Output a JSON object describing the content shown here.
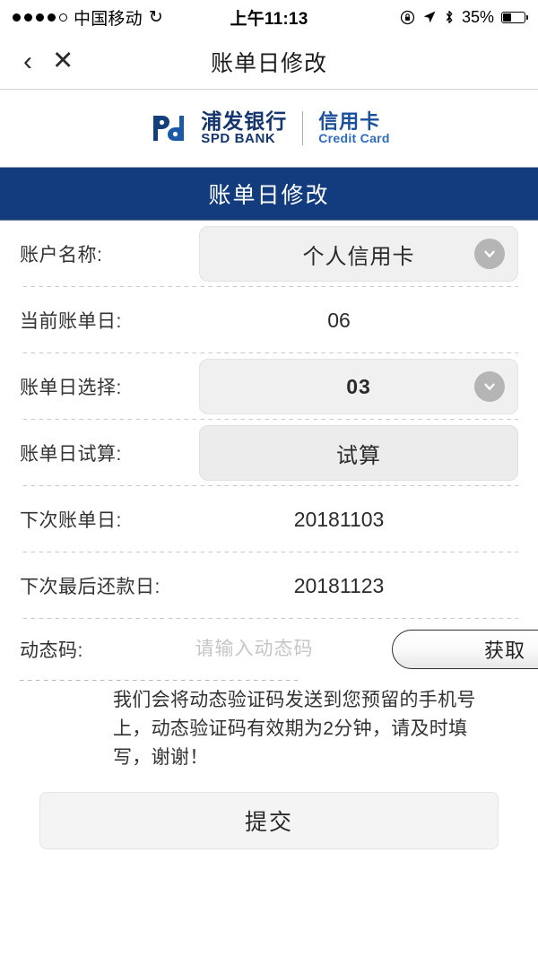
{
  "status_bar": {
    "signal_dots_filled": 4,
    "signal_dots_total": 5,
    "carrier": "中国移动",
    "sync_icon": "spiral-icon",
    "time": "上午11:13",
    "rotation_lock_icon": "rotation-lock-icon",
    "location_icon": "location-arrow-icon",
    "bluetooth_icon": "bluetooth-icon",
    "battery_percent": "35%",
    "battery_level": 35
  },
  "nav": {
    "back_icon": "chevron-left-icon",
    "close_icon": "close-icon",
    "title": "账单日修改"
  },
  "brand": {
    "logo_icon": "spd-bank-logo-icon",
    "name_cn": "浦发银行",
    "name_en": "SPD BANK",
    "product_cn": "信用卡",
    "product_en": "Credit Card",
    "color": "#15356e"
  },
  "banner": {
    "title": "账单日修改",
    "background": "#123c7e"
  },
  "form": {
    "account_name": {
      "label": "账户名称:",
      "value": "个人信用卡",
      "chevron_icon": "chevron-down-circle-icon"
    },
    "current_bill_date": {
      "label": "当前账单日:",
      "value": "06"
    },
    "bill_date_select": {
      "label": "账单日选择:",
      "value": "03",
      "chevron_icon": "chevron-down-circle-icon"
    },
    "bill_date_trial": {
      "label": "账单日试算:",
      "button_label": "试算"
    },
    "next_bill_date": {
      "label": "下次账单日:",
      "value": "20181103"
    },
    "next_repayment_date": {
      "label": "下次最后还款日:",
      "value": "20181123"
    },
    "dynamic_code": {
      "label": "动态码:",
      "placeholder": "请输入动态码",
      "value": "",
      "get_button_label": "获取"
    },
    "note": "我们会将动态验证码发送到您预留的手机号上，动态验证码有效期为2分钟，请及时填写，谢谢！",
    "submit_label": "提交"
  }
}
